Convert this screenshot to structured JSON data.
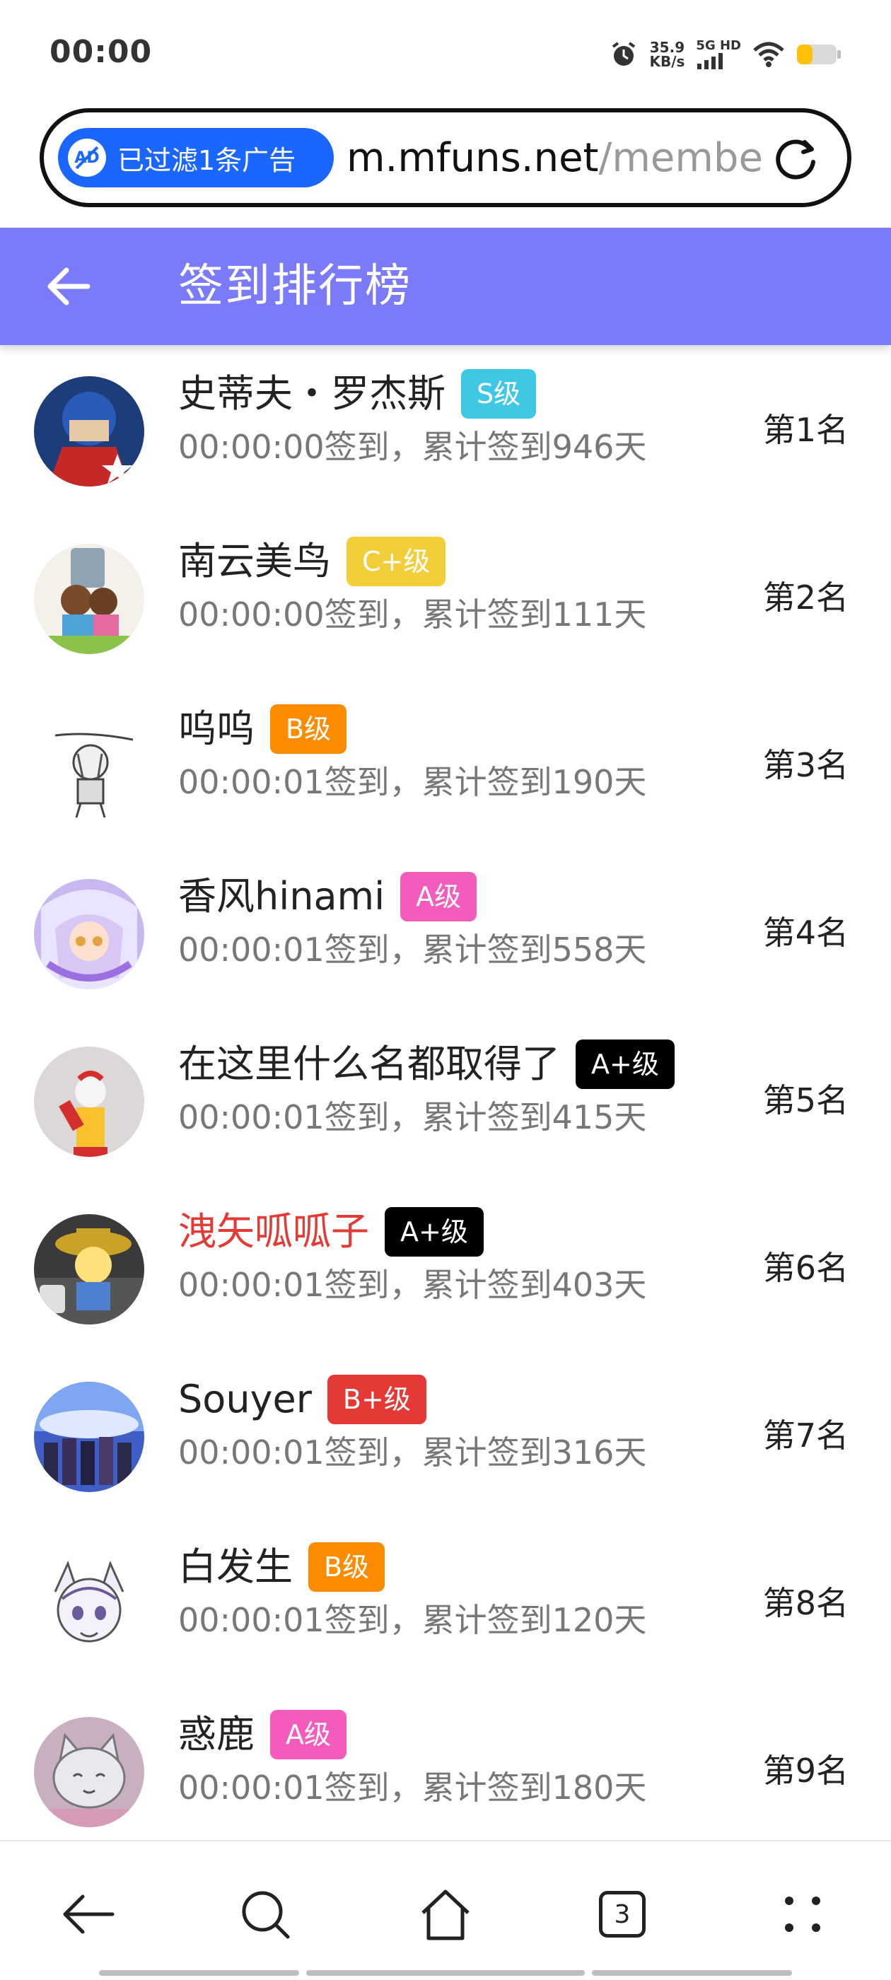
{
  "status_bar": {
    "time": "00:00",
    "net_speed_value": "35.9",
    "net_speed_unit": "KB/s",
    "network_type": "5G HD",
    "icons": [
      "alarm-icon",
      "signal-icon",
      "wifi-icon",
      "battery-icon"
    ]
  },
  "address_bar": {
    "adblock_label": "已过滤1条广告",
    "url_host": "m.mfuns.net",
    "url_path": "/membe"
  },
  "header": {
    "title": "签到排行榜",
    "background_color": "#7b7bfa"
  },
  "ranking": [
    {
      "name": "史蒂夫・罗杰斯",
      "level": "S级",
      "level_color": "#3fc8e4",
      "info": "00:00:00签到，累计签到946天",
      "rank": "第1名",
      "name_color": "#222222"
    },
    {
      "name": "南云美鸟",
      "level": "C+级",
      "level_color": "#f2cf3a",
      "info": "00:00:00签到，累计签到111天",
      "rank": "第2名",
      "name_color": "#222222"
    },
    {
      "name": "呜呜",
      "level": "B级",
      "level_color": "#fb8c00",
      "info": "00:00:01签到，累计签到190天",
      "rank": "第3名",
      "name_color": "#222222"
    },
    {
      "name": "香风hinami",
      "level": "A级",
      "level_color": "#f45bbd",
      "info": "00:00:01签到，累计签到558天",
      "rank": "第4名",
      "name_color": "#222222"
    },
    {
      "name": "在这里什么名都取得了",
      "level": "A+级",
      "level_color": "#000000",
      "info": "00:00:01签到，累计签到415天",
      "rank": "第5名",
      "name_color": "#222222"
    },
    {
      "name": "洩矢呱呱子",
      "level": "A+级",
      "level_color": "#000000",
      "info": "00:00:01签到，累计签到403天",
      "rank": "第6名",
      "name_color": "#e53935"
    },
    {
      "name": "Souyer",
      "level": "B+级",
      "level_color": "#e53935",
      "info": "00:00:01签到，累计签到316天",
      "rank": "第7名",
      "name_color": "#222222"
    },
    {
      "name": "白发生",
      "level": "B级",
      "level_color": "#fb8c00",
      "info": "00:00:01签到，累计签到120天",
      "rank": "第8名",
      "name_color": "#222222"
    },
    {
      "name": "惑鹿",
      "level": "A级",
      "level_color": "#f45bbd",
      "info": "00:00:01签到，累计签到180天",
      "rank": "第9名",
      "name_color": "#222222"
    }
  ],
  "bottom_nav": {
    "tab_count": "3",
    "items": [
      "back-icon",
      "search-icon",
      "home-icon",
      "tabs-icon",
      "menu-icon"
    ]
  }
}
